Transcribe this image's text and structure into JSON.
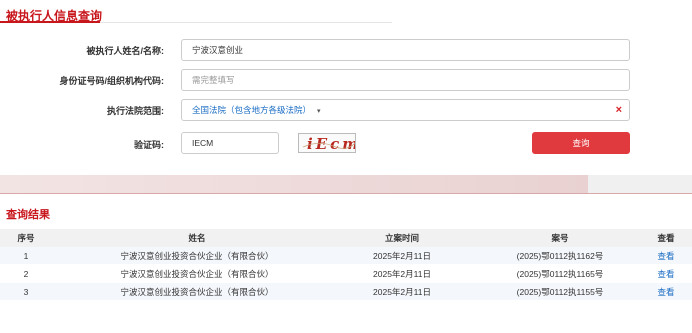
{
  "form": {
    "title": "被执行人信息查询",
    "name_label": "被执行人姓名/名称:",
    "name_value": "宁波汉意创业",
    "id_label": "身份证号码/组织机构代码:",
    "id_placeholder": "需完整填写",
    "court_label": "执行法院范围:",
    "court_value": "全国法院（包含地方各级法院）",
    "caret": "▾",
    "clear": "×",
    "captcha_label": "验证码:",
    "captcha_value": "IECM",
    "captcha_image_text": "iEcm",
    "search_label": "查询"
  },
  "results": {
    "title": "查询结果",
    "columns": [
      "序号",
      "姓名",
      "立案时间",
      "案号",
      "查看"
    ],
    "rows": [
      {
        "no": "1",
        "name": "宁波汉意创业投资合伙企业（有限合伙）",
        "date": "2025年2月11日",
        "case": "(2025)鄂0112执1162号",
        "view": "查看"
      },
      {
        "no": "2",
        "name": "宁波汉意创业投资合伙企业（有限合伙）",
        "date": "2025年2月11日",
        "case": "(2025)鄂0112执1165号",
        "view": "查看"
      },
      {
        "no": "3",
        "name": "宁波汉意创业投资合伙企业（有限合伙）",
        "date": "2025年2月11日",
        "case": "(2025)鄂0112执1155号",
        "view": "查看"
      }
    ]
  },
  "colors": {
    "brand_red": "#c8161d",
    "button_red": "#e03a3e",
    "link_blue": "#1a6cc4"
  }
}
